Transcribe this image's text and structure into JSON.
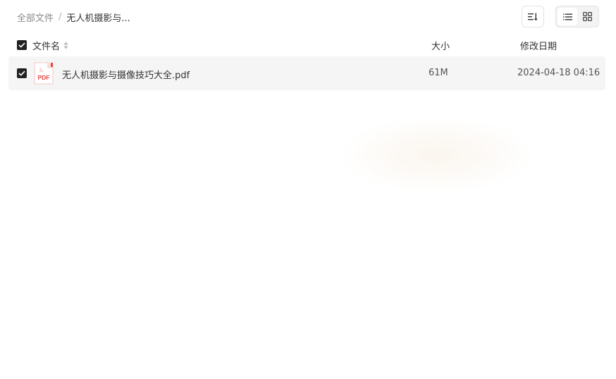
{
  "breadcrumb": {
    "root": "全部文件",
    "separator": "/",
    "current": "无人机摄影与..."
  },
  "toolbar": {
    "sort_icon": "sort-list-icon",
    "view_modes": [
      "list-view-icon",
      "grid-view-icon"
    ],
    "active_view": "list"
  },
  "table": {
    "columns": {
      "name": "文件名",
      "size": "大小",
      "date": "修改日期"
    },
    "rows": [
      {
        "name": "无人机摄影与摄像技巧大全.pdf",
        "size": "61M",
        "date": "2024-04-18 04:16",
        "icon": "pdf-file-icon",
        "icon_label": "PDF",
        "checked": true
      }
    ]
  },
  "colors": {
    "checkbox": "#222222",
    "row_bg": "#f5f5f5",
    "pdf_red": "#e5463f"
  }
}
